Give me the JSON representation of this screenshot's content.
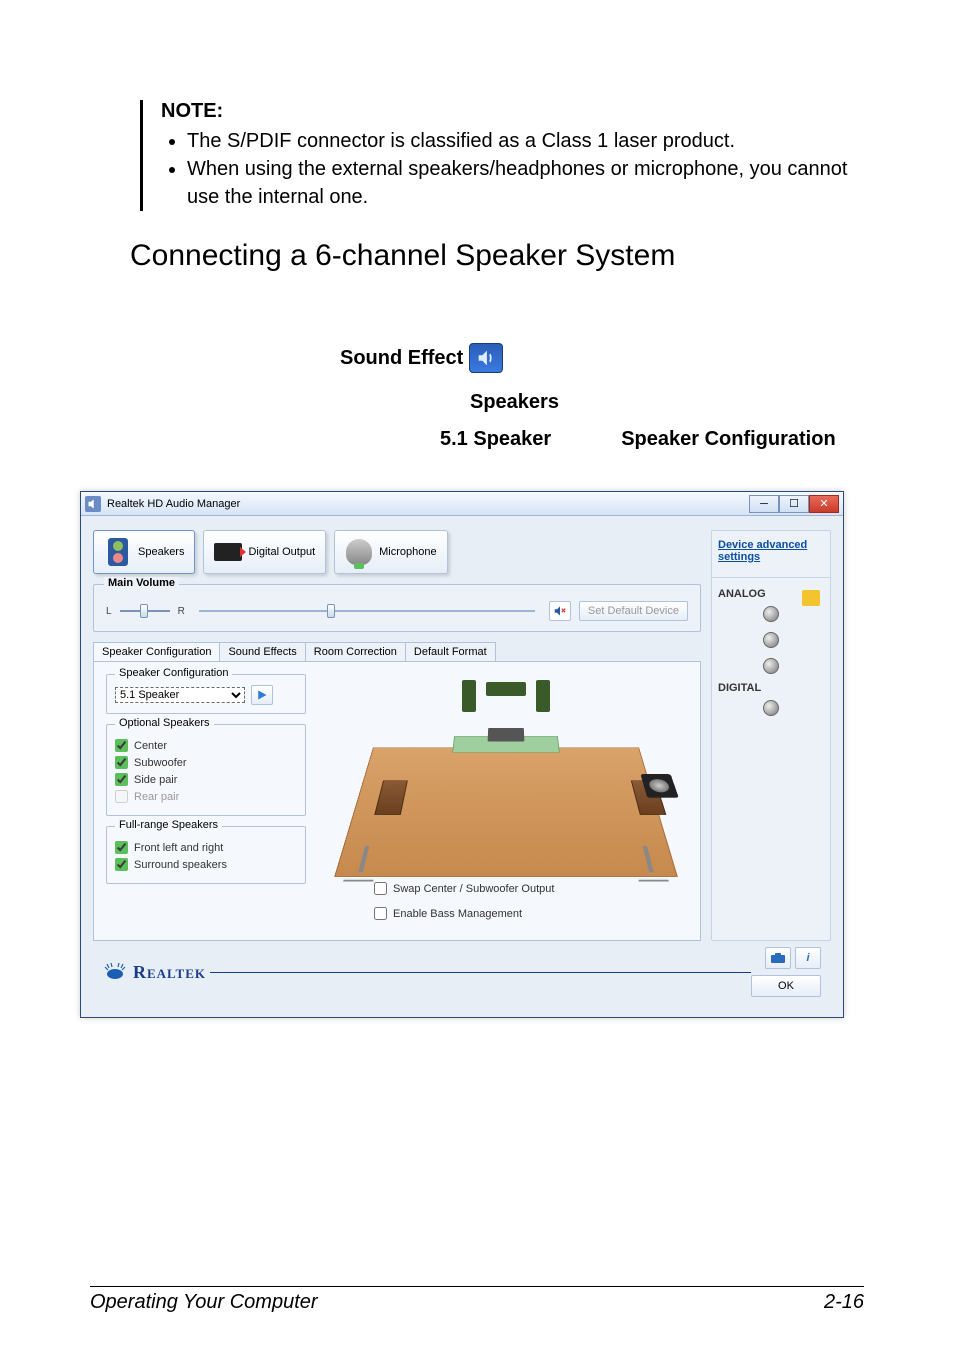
{
  "note": {
    "title": "NOTE:",
    "items": [
      "The S/PDIF connector is classified as a Class 1 laser product.",
      "When using the external speakers/headphones or microphone, you cannot use the internal one."
    ]
  },
  "headings": {
    "section": "Connecting a 6-channel Speaker System",
    "sound_effect": "Sound Effect",
    "speakers": "Speakers",
    "sel51": "5.1 Speaker",
    "spkcfg": "Speaker Configuration"
  },
  "window": {
    "title": "Realtek HD Audio Manager",
    "device_tabs": {
      "speakers": "Speakers",
      "digital_output": "Digital Output",
      "microphone": "Microphone"
    },
    "main_volume": {
      "title": "Main Volume",
      "L": "L",
      "R": "R",
      "set_default": "Set Default Device"
    },
    "subtabs": {
      "spk_cfg": "Speaker Configuration",
      "sound_fx": "Sound Effects",
      "room_corr": "Room Correction",
      "def_fmt": "Default Format"
    },
    "speaker_cfg": {
      "group_title": "Speaker Configuration",
      "selected": "5.1 Speaker",
      "optional_title": "Optional Speakers",
      "opt_center": "Center",
      "opt_sub": "Subwoofer",
      "opt_side": "Side pair",
      "opt_rear": "Rear pair",
      "fullrange_title": "Full-range Speakers",
      "fr_front": "Front left and right",
      "fr_surround": "Surround speakers",
      "swap": "Swap Center / Subwoofer Output",
      "bass": "Enable Bass Management"
    },
    "right": {
      "adv_link": "Device advanced settings",
      "analog": "ANALOG",
      "digital": "DIGITAL"
    },
    "footer": {
      "brand": "Realtek",
      "ok": "OK",
      "info_i": "i"
    }
  },
  "page_footer": {
    "left": "Operating Your Computer",
    "right": "2-16"
  }
}
